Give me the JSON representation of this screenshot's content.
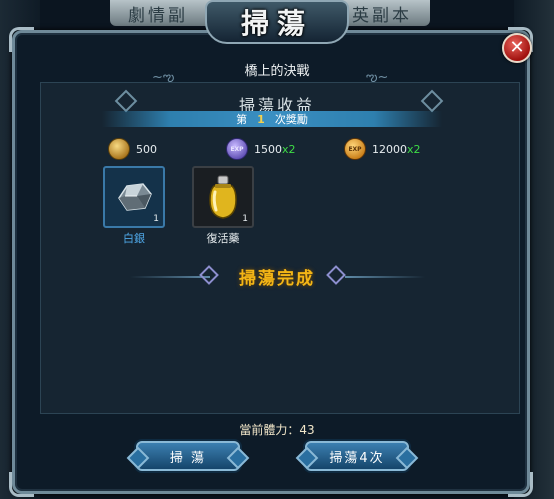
{
  "background": {
    "top_tab_left": "劇情副",
    "top_tab_right": "精英副本"
  },
  "dialog": {
    "title": "掃蕩",
    "stage_name": "橋上的決戰",
    "reward_heading": "掃蕩收益",
    "round_prefix": "第",
    "round_number": "1",
    "round_suffix": "次獎勵",
    "stats": [
      {
        "icon": "silver-coin-icon",
        "icon_text": "",
        "value": "500",
        "multiplier": ""
      },
      {
        "icon": "exp-orb-icon",
        "icon_text": "EXP",
        "value": "1500",
        "multiplier": "x2"
      },
      {
        "icon": "exp-coin-icon",
        "icon_text": "EXP",
        "value": "12000",
        "multiplier": "x2"
      }
    ],
    "items": [
      {
        "name": "白銀",
        "count": "1",
        "name_color": "#4fa8e8"
      },
      {
        "name": "復活藥",
        "count": "1",
        "name_color": "#e9eef0"
      }
    ],
    "complete_text": "掃蕩完成",
    "stamina_label": "當前體力：",
    "stamina_value": "43",
    "buttons": {
      "sweep": "掃 蕩",
      "sweep_four": "掃蕩4次"
    }
  },
  "colors": {
    "accent_blue": "#3a8fc2",
    "gold_text": "#f4b616",
    "bonus_green": "#3ddc45",
    "close_red": "#a1120f"
  }
}
